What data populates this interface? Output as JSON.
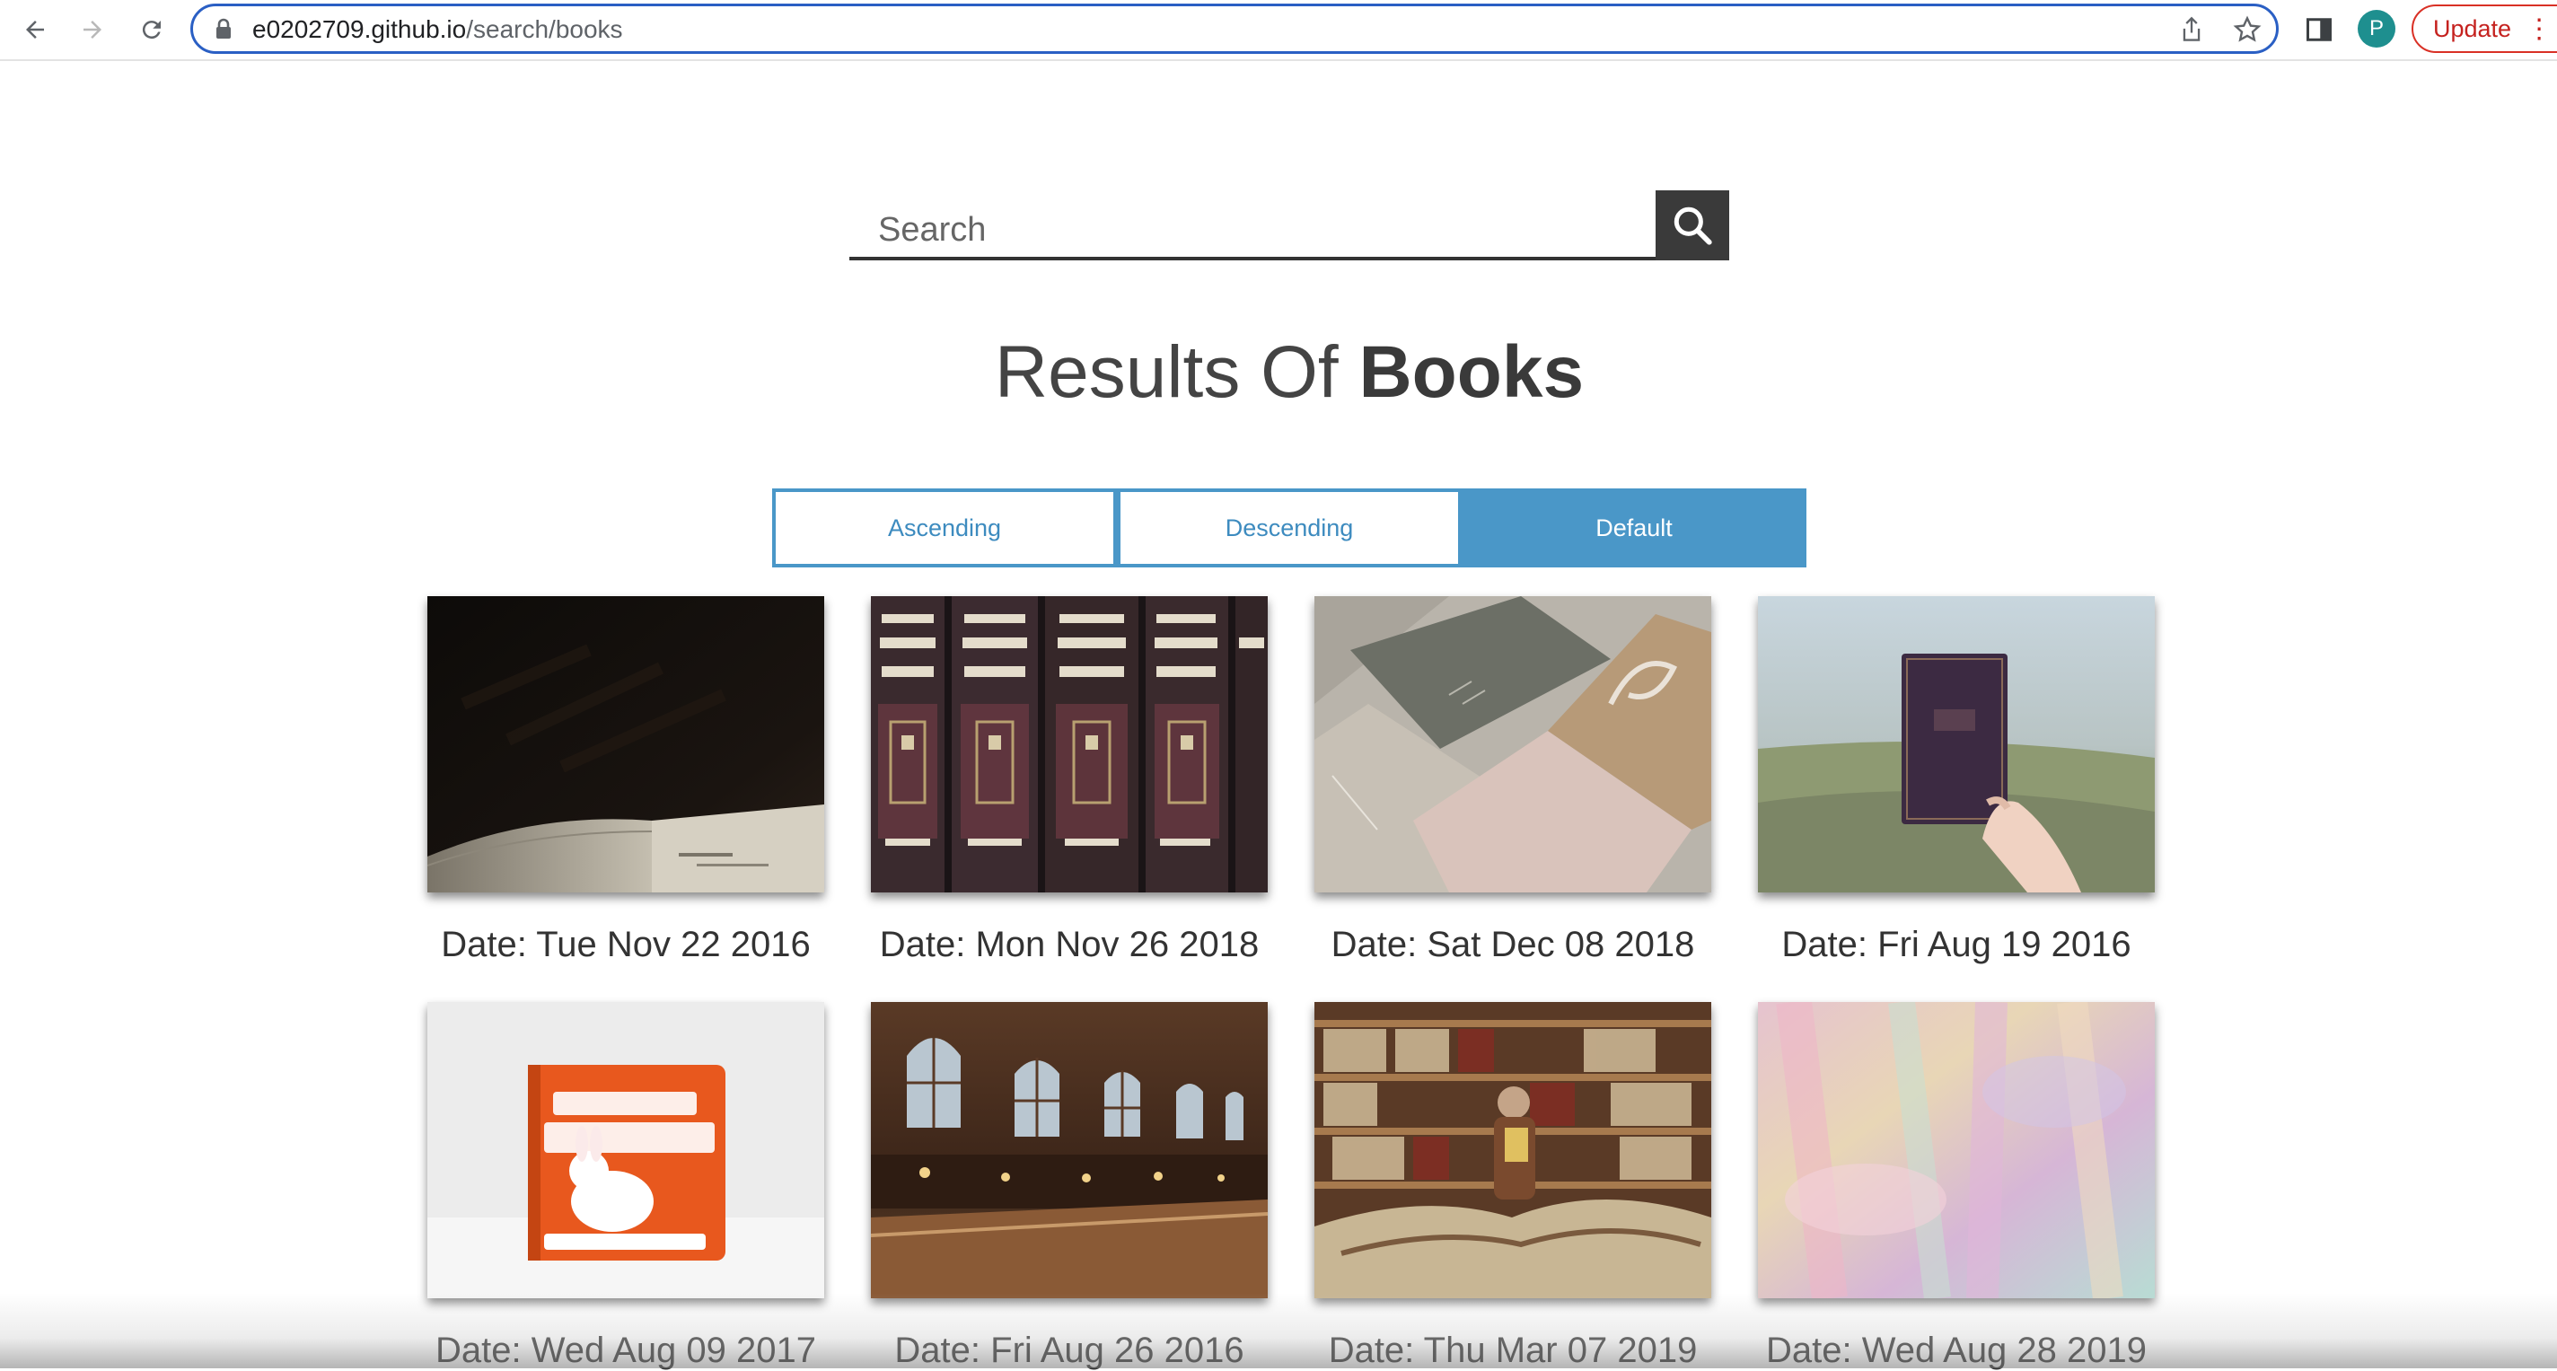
{
  "browser": {
    "url_host": "e0202709.github.io",
    "url_path": "/search/books",
    "profile_initial": "P",
    "update_label": "Update",
    "update_more": "⋮"
  },
  "search": {
    "placeholder": "Search"
  },
  "results": {
    "prefix": "Results Of ",
    "query": "Books"
  },
  "sort": {
    "ascending": "Ascending",
    "descending": "Descending",
    "default": "Default",
    "active": "default"
  },
  "books": [
    {
      "date": "Date: Tue Nov 22 2016",
      "image": "open-old-book-dark"
    },
    {
      "date": "Date: Mon Nov 26 2018",
      "image": "hebrew-book-spines"
    },
    {
      "date": "Date: Sat Dec 08 2018",
      "image": "pastel-notebooks"
    },
    {
      "date": "Date: Fri Aug 19 2016",
      "image": "hand-holding-book"
    },
    {
      "date": "Date: Wed Aug 09 2017",
      "image": "baby-animals-book"
    },
    {
      "date": "Date: Fri Aug 26 2016",
      "image": "library-reading-room"
    },
    {
      "date": "Date: Thu Mar 07 2019",
      "image": "bookshop-stacks"
    },
    {
      "date": "Date: Wed Aug 28 2019",
      "image": "pastel-watercolor"
    }
  ],
  "colors": {
    "accent": "#4a97c8",
    "search_button": "#3a3a3a",
    "omnibox_border": "#2a5fc4",
    "update_red": "#d93025"
  }
}
